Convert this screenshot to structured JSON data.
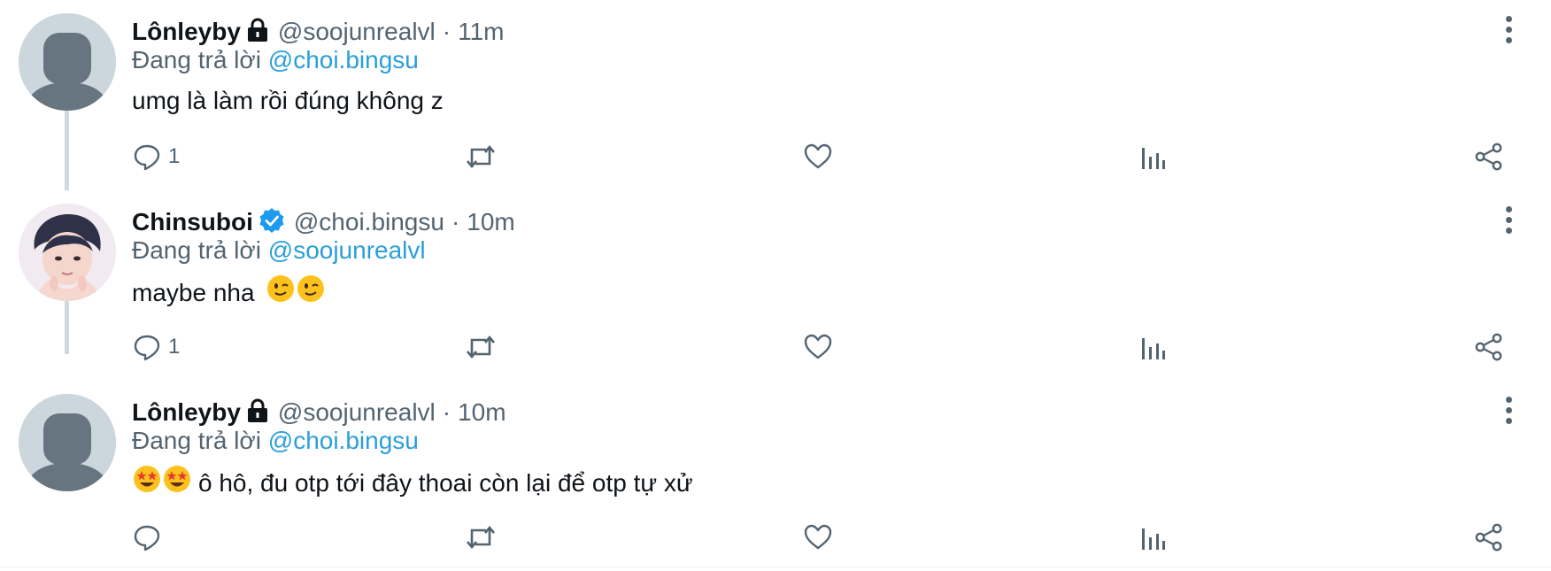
{
  "tweets": [
    {
      "name": "Lônleyby",
      "badge": "lock",
      "handle": "@soojunrealvl",
      "separator": "·",
      "time": "11m",
      "reply_prefix": "Đang trả lời",
      "reply_to": "@choi.bingsu",
      "text": "umg là làm rồi đúng không z",
      "avatar": "default-avatar",
      "actions": {
        "reply_count": "1",
        "retweet_count": "",
        "like_count": "",
        "views_count": ""
      }
    },
    {
      "name": "Chinsuboi",
      "badge": "verified",
      "handle": "@choi.bingsu",
      "separator": "·",
      "time": "10m",
      "reply_prefix": "Đang trả lời",
      "reply_to": "@soojunrealvl",
      "text": "maybe nha",
      "text_emojis": [
        "winking-face",
        "winking-face"
      ],
      "avatar": "photo-avatar",
      "actions": {
        "reply_count": "1",
        "retweet_count": "",
        "like_count": "",
        "views_count": ""
      }
    },
    {
      "name": "Lônleyby",
      "badge": "lock",
      "handle": "@soojunrealvl",
      "separator": "·",
      "time": "10m",
      "reply_prefix": "Đang trả lời",
      "reply_to": "@choi.bingsu",
      "text": "ô hô, đu otp tới đây thoai còn lại để otp tự xử",
      "text_leading_emojis": [
        "star-struck",
        "star-struck"
      ],
      "avatar": "default-avatar",
      "actions": {
        "reply_count": "",
        "retweet_count": "",
        "like_count": "",
        "views_count": ""
      }
    }
  ],
  "colors": {
    "text_primary": "#0f1419",
    "text_secondary": "#536471",
    "link": "#2a9fd8",
    "verified": "#1d9bf0",
    "thread_line": "#cfd9de"
  }
}
